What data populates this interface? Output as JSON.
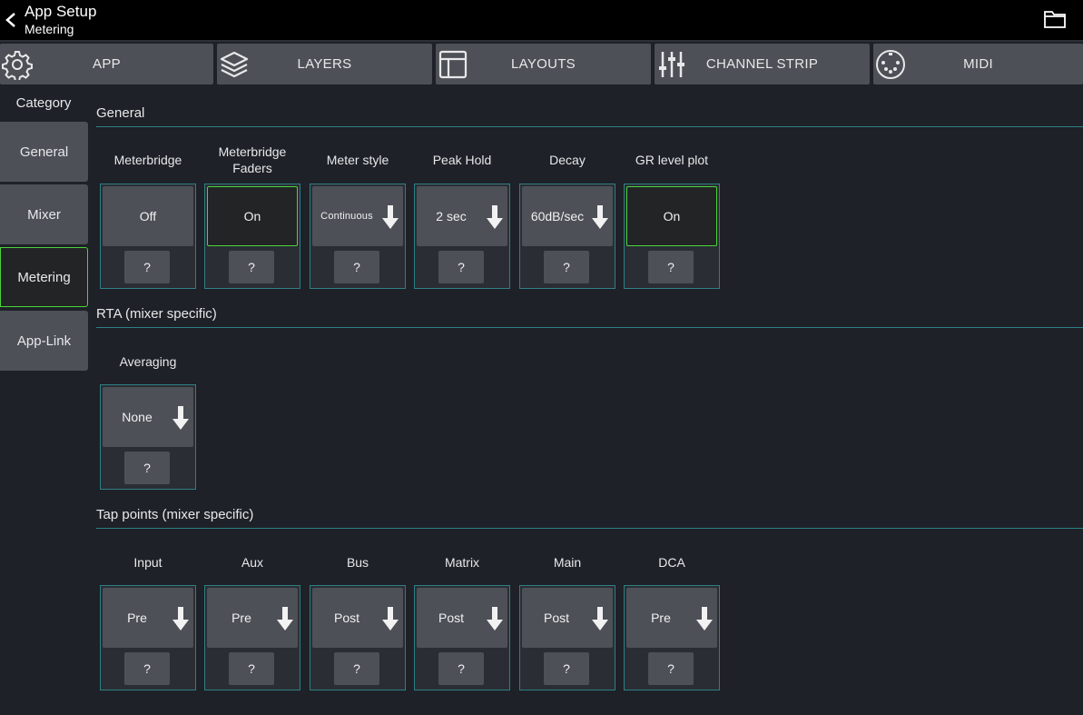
{
  "header": {
    "title": "App Setup",
    "subtitle": "Metering",
    "back_icon": "chevron-left-icon",
    "folder_icon": "folder-icon"
  },
  "tabs": [
    {
      "label": "APP",
      "icon": "gear-icon"
    },
    {
      "label": "LAYERS",
      "icon": "layers-icon"
    },
    {
      "label": "LAYOUTS",
      "icon": "layout-icon"
    },
    {
      "label": "CHANNEL STRIP",
      "icon": "sliders-icon"
    },
    {
      "label": "MIDI",
      "icon": "midi-port-icon"
    }
  ],
  "sidebar": {
    "title": "Category",
    "items": [
      {
        "label": "General",
        "active": false
      },
      {
        "label": "Mixer",
        "active": false
      },
      {
        "label": "Metering",
        "active": true
      },
      {
        "label": "App-Link",
        "active": false
      }
    ]
  },
  "sections": {
    "general": {
      "title": "General",
      "controls": [
        {
          "label": "Meterbridge",
          "value": "Off",
          "help": "?"
        },
        {
          "label": "Meterbridge Faders",
          "value": "On",
          "help": "?"
        },
        {
          "label": "Meter style",
          "value": "Continuous",
          "help": "?"
        },
        {
          "label": "Peak Hold",
          "value": "2 sec",
          "help": "?"
        },
        {
          "label": "Decay",
          "value": "60dB/sec",
          "help": "?"
        },
        {
          "label": "GR level plot",
          "value": "On",
          "help": "?"
        }
      ]
    },
    "rta": {
      "title": "RTA (mixer specific)",
      "controls": [
        {
          "label": "Averaging",
          "value": "None",
          "help": "?"
        }
      ]
    },
    "tap": {
      "title": "Tap points (mixer specific)",
      "controls": [
        {
          "label": "Input",
          "value": "Pre",
          "help": "?"
        },
        {
          "label": "Aux",
          "value": "Pre",
          "help": "?"
        },
        {
          "label": "Bus",
          "value": "Post",
          "help": "?"
        },
        {
          "label": "Matrix",
          "value": "Post",
          "help": "?"
        },
        {
          "label": "Main",
          "value": "Post",
          "help": "?"
        },
        {
          "label": "DCA",
          "value": "Pre",
          "help": "?"
        }
      ]
    }
  },
  "colors": {
    "background": "#1e2127",
    "button": "#4d5057",
    "active_border": "#4cd43a",
    "section_line": "#2e7f86"
  }
}
